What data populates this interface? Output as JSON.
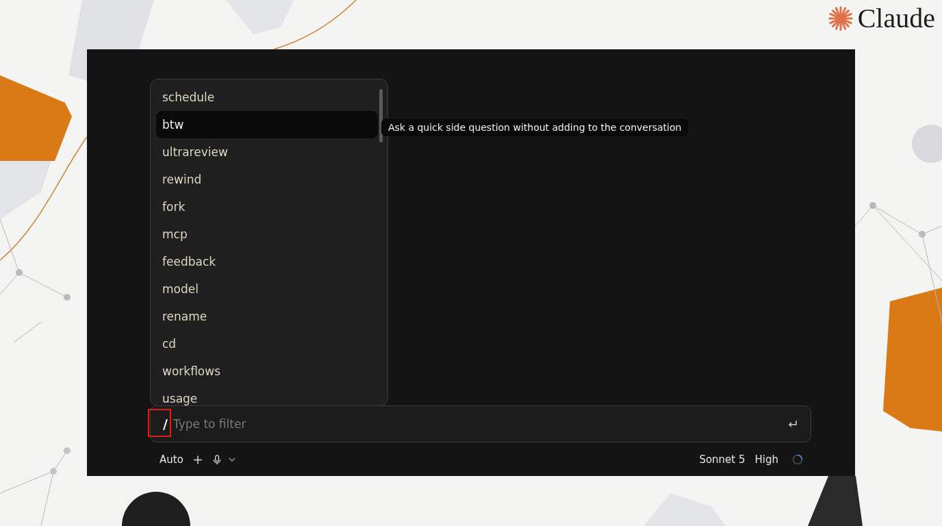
{
  "brand": {
    "name": "Claude"
  },
  "command_menu": {
    "items": [
      {
        "label": "schedule",
        "selected": false
      },
      {
        "label": "btw",
        "selected": true
      },
      {
        "label": "ultrareview",
        "selected": false
      },
      {
        "label": "rewind",
        "selected": false
      },
      {
        "label": "fork",
        "selected": false
      },
      {
        "label": "mcp",
        "selected": false
      },
      {
        "label": "feedback",
        "selected": false
      },
      {
        "label": "model",
        "selected": false
      },
      {
        "label": "rename",
        "selected": false
      },
      {
        "label": "cd",
        "selected": false
      },
      {
        "label": "workflows",
        "selected": false
      },
      {
        "label": "usage",
        "selected": false
      }
    ]
  },
  "tooltip": {
    "text": "Ask a quick side question without adding to the conversation"
  },
  "input": {
    "prefix": "/",
    "placeholder": "Type to filter",
    "highlighted": true
  },
  "toolbar": {
    "mode": "Auto",
    "model": "Sonnet 5",
    "effort": "High"
  }
}
